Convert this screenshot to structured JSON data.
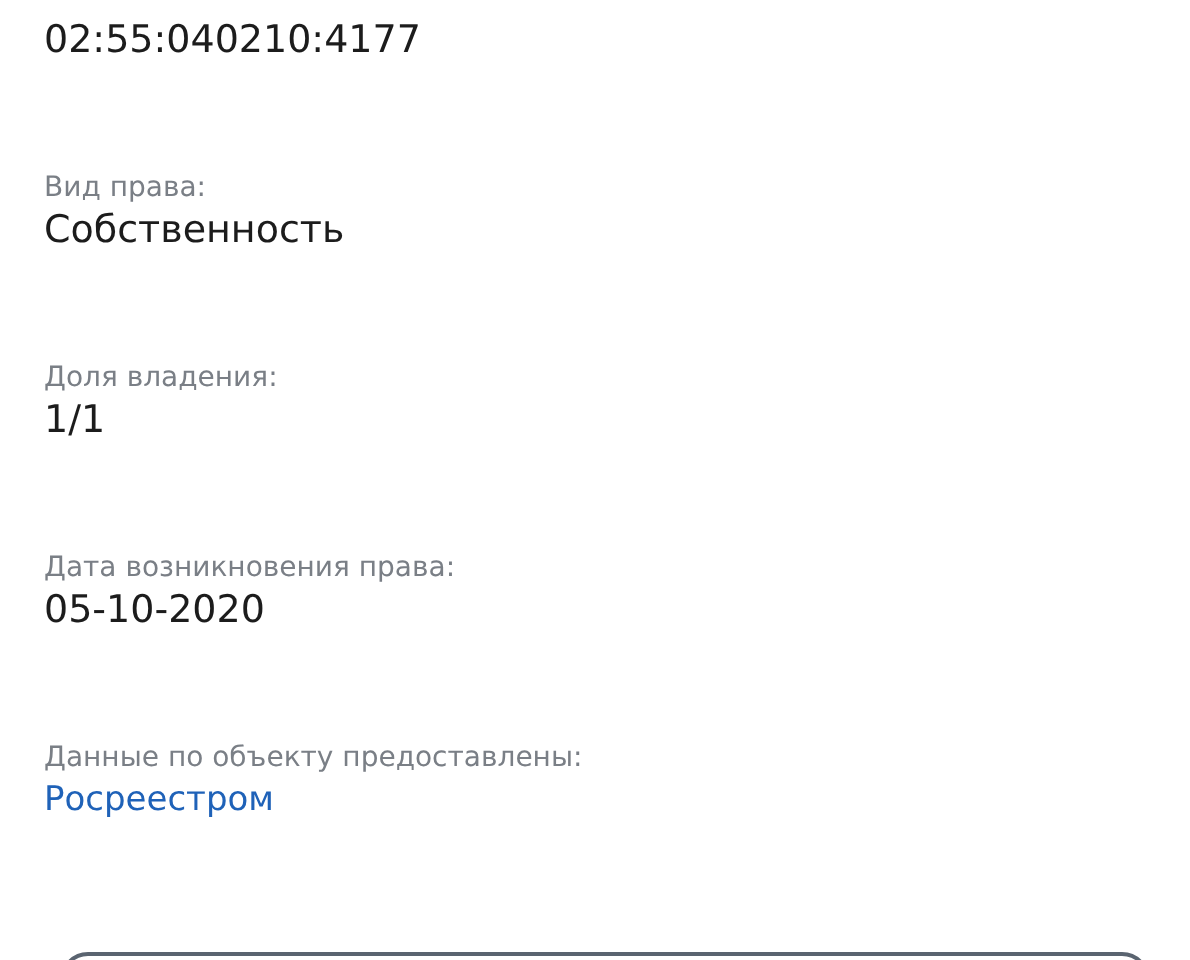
{
  "fields": [
    {
      "value": "02:55:040210:4177",
      "kind": "text"
    },
    {
      "label": "Вид права:",
      "value": "Собственность",
      "kind": "text"
    },
    {
      "label": "Доля владения:",
      "value": "1/1",
      "kind": "text"
    },
    {
      "label": "Дата возникновения права:",
      "value": "05-10-2020",
      "kind": "text"
    },
    {
      "label": "Данные по объекту предоставлены:",
      "value": "Росреестром",
      "kind": "link"
    }
  ]
}
